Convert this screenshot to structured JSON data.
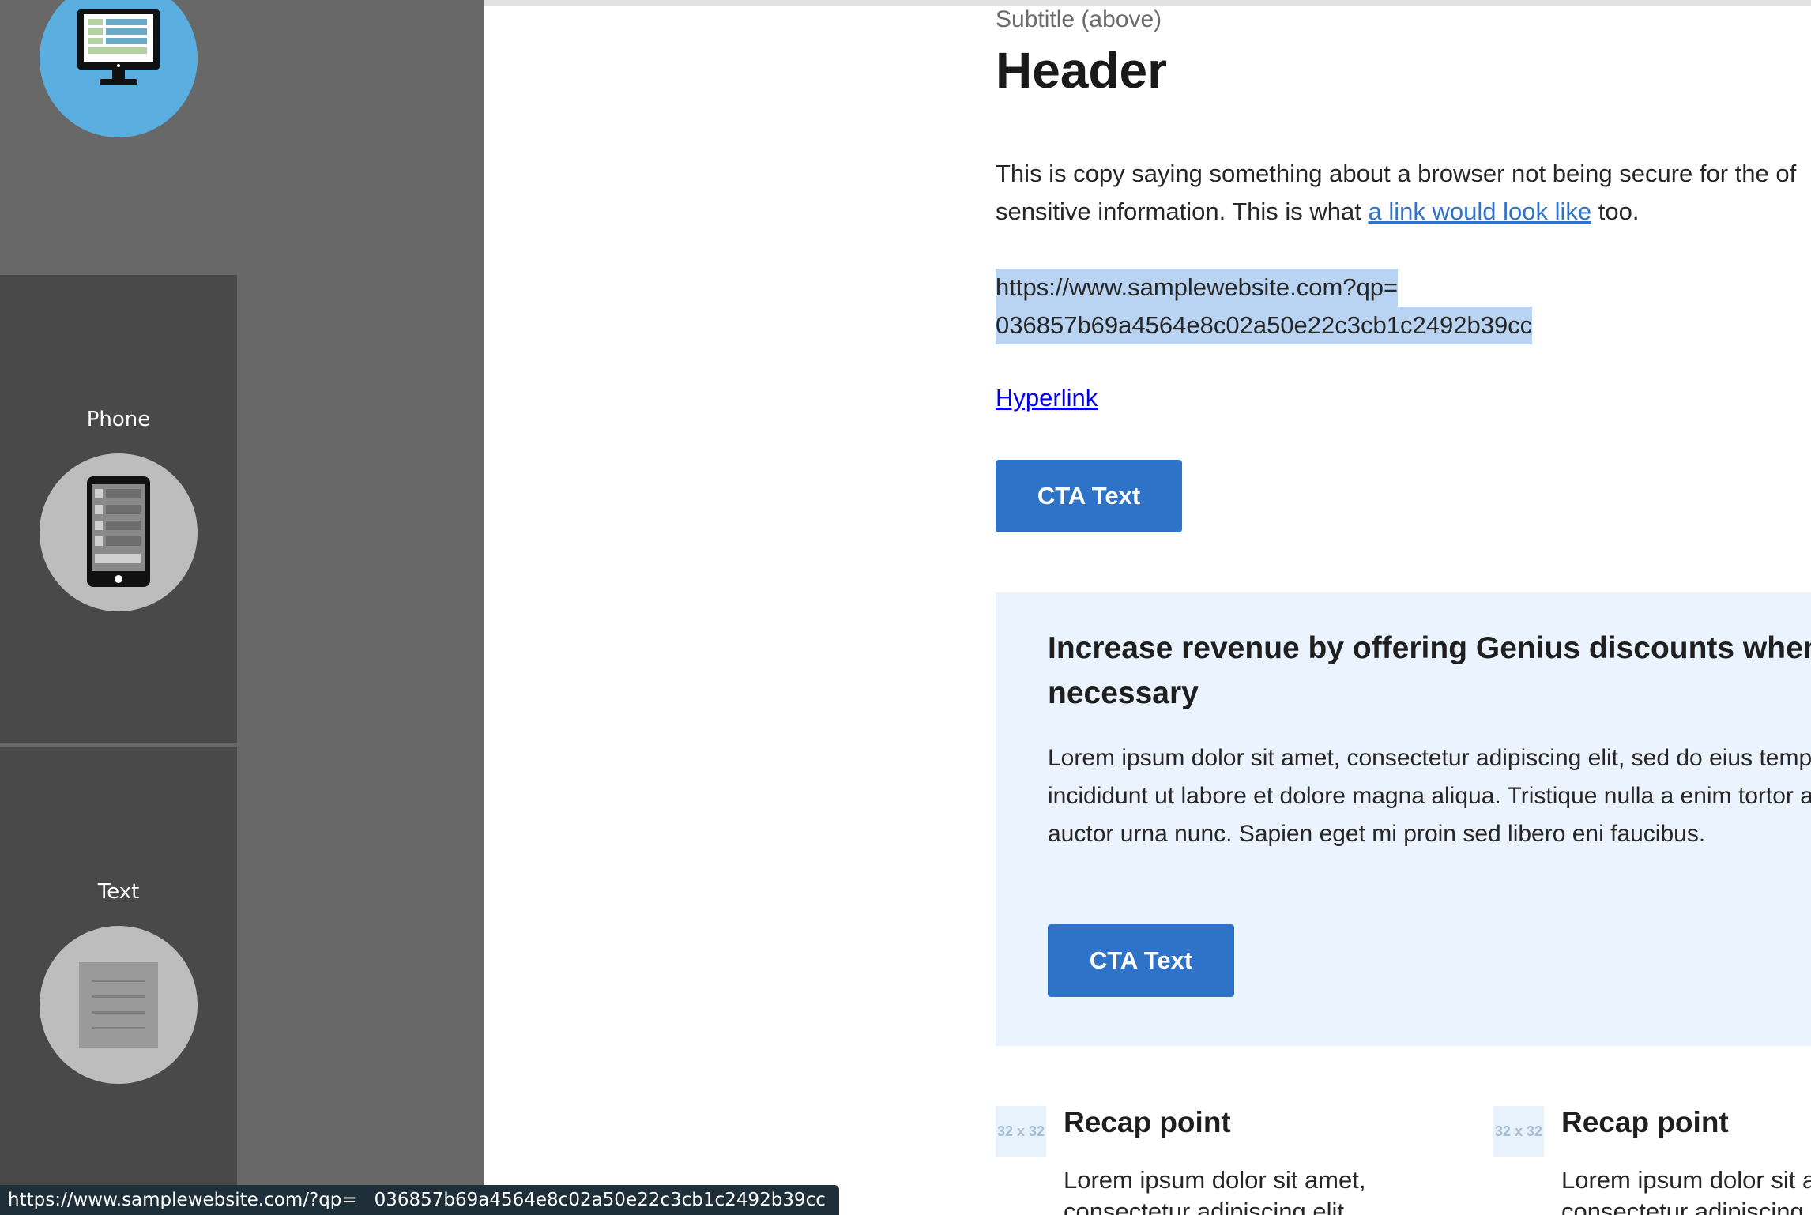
{
  "sidebar": {
    "tiles": [
      {
        "label": "",
        "icon": "desktop-monitor-icon"
      },
      {
        "label": "Phone",
        "icon": "phone-icon"
      },
      {
        "label": "Text",
        "icon": "document-icon"
      }
    ]
  },
  "main": {
    "subtitle": "Subtitle (above)",
    "header": "Header",
    "copy_before": "This is copy saying something about a browser not being secure for the of sensitive information. This is what ",
    "copy_link": "a link would look like",
    "copy_after": " too.",
    "url_line1": "https://www.samplewebsite.com?qp=",
    "url_line2": "036857b69a4564e8c02a50e22c3cb1c2492b39cc",
    "hyperlink": "Hyperlink",
    "cta_label": "CTA Text"
  },
  "promo": {
    "title": "Increase revenue by offering Genius discounts when necessary",
    "body": "Lorem ipsum dolor sit amet, consectetur adipiscing elit, sed do eius tempor incididunt ut labore et dolore magna aliqua. Tristique nulla a enim tortor at auctor urna nunc. Sapien eget mi proin sed libero eni faucibus.",
    "cta_label": "CTA Text"
  },
  "recaps": [
    {
      "placeholder": "32 x 32",
      "title": "Recap point",
      "body": "Lorem ipsum dolor sit amet, consectetur adipiscing elit"
    },
    {
      "placeholder": "32 x 32",
      "title": "Recap point",
      "body": "Lorem ipsum dolor sit amet, consectetur adipiscing elit"
    }
  ],
  "status_bar": {
    "url": "https://www.samplewebsite.com/?qp=   036857b69a4564e8c02a50e22c3cb1c2492b39cc"
  },
  "colors": {
    "accent": "#2e73c8",
    "selection": "#b9d3f3",
    "promo_bg": "#ebf3fe",
    "rail_bg": "#686868",
    "tile_bg": "#494949"
  }
}
